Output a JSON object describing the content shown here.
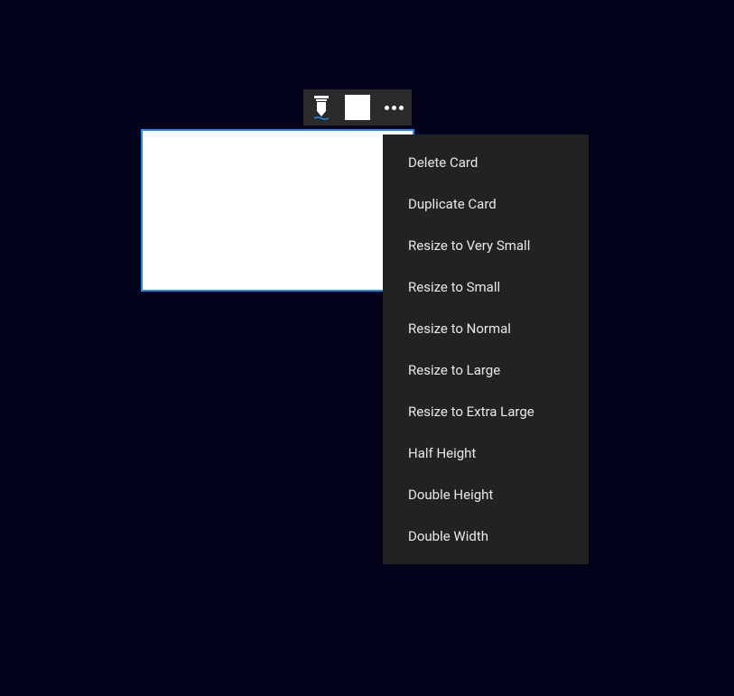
{
  "toolbar": {
    "pen_tool": "pen-tool",
    "color": "#ffffff",
    "more": "more-options"
  },
  "menu": {
    "items": [
      "Delete Card",
      "Duplicate Card",
      "Resize to Very Small",
      "Resize to Small",
      "Resize to Normal",
      "Resize to Large",
      "Resize to Extra Large",
      "Half Height",
      "Double Height",
      "Double Width"
    ]
  }
}
